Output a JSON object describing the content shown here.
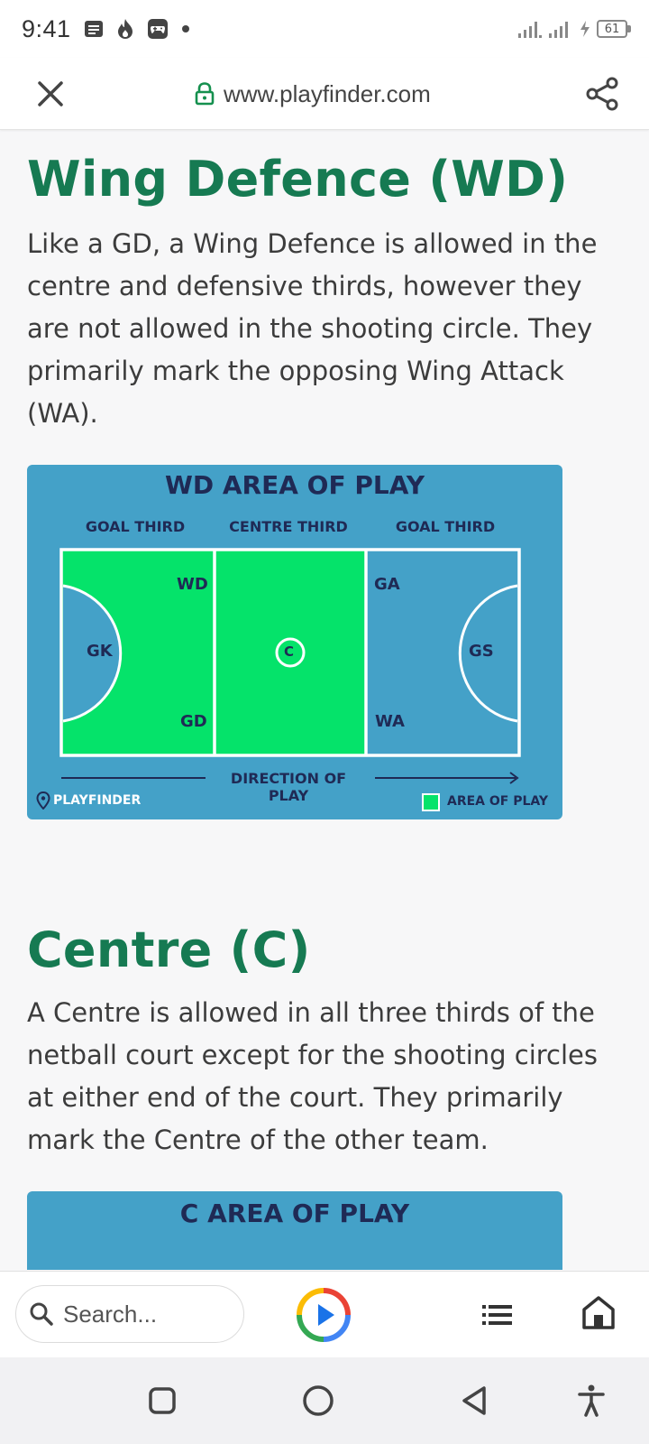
{
  "status_bar": {
    "time": "9:41",
    "battery": "61"
  },
  "browser": {
    "url": "www.playfinder.com"
  },
  "sections": [
    {
      "heading": "Wing Defence (WD)",
      "paragraph": "Like a GD, a Wing Defence is allowed in the centre and defensive thirds, however they are not allowed in the shooting circle. They primarily mark the opposing Wing Attack (WA).",
      "diagram": {
        "title": "WD AREA OF PLAY",
        "thirds": [
          "GOAL THIRD",
          "CENTRE THIRD",
          "GOAL THIRD"
        ],
        "positions": {
          "gk": "GK",
          "wd": "WD",
          "gd": "GD",
          "c": "C",
          "ga": "GA",
          "wa": "WA",
          "gs": "GS"
        },
        "direction": "DIRECTION OF PLAY",
        "brand": "PLAYFINDER",
        "legend": "AREA OF PLAY",
        "colors": {
          "background": "#44a1c8",
          "area_of_play": "#05e36a",
          "lines": "#ffffff",
          "text": "#1f2a55"
        }
      }
    },
    {
      "heading": "Centre (C)",
      "paragraph": "A Centre is allowed in all three thirds of the netball court except for the shooting circles at either end of the court. They primarily mark the Centre of the other team.",
      "diagram": {
        "title": "C AREA OF PLAY"
      }
    }
  ],
  "bottom_bar": {
    "search_placeholder": "Search..."
  },
  "icons": {
    "status": [
      "message-icon",
      "fire-icon",
      "gamepad-icon",
      "dot-icon",
      "signal-icon",
      "signal-icon",
      "charging-icon",
      "battery-icon"
    ],
    "browser": [
      "close-icon",
      "lock-icon",
      "share-icon"
    ],
    "bottom": [
      "search-icon",
      "play-icon",
      "list-icon",
      "home-icon"
    ],
    "system_nav": [
      "recents-icon",
      "home-circle-icon",
      "back-icon",
      "accessibility-icon"
    ]
  }
}
